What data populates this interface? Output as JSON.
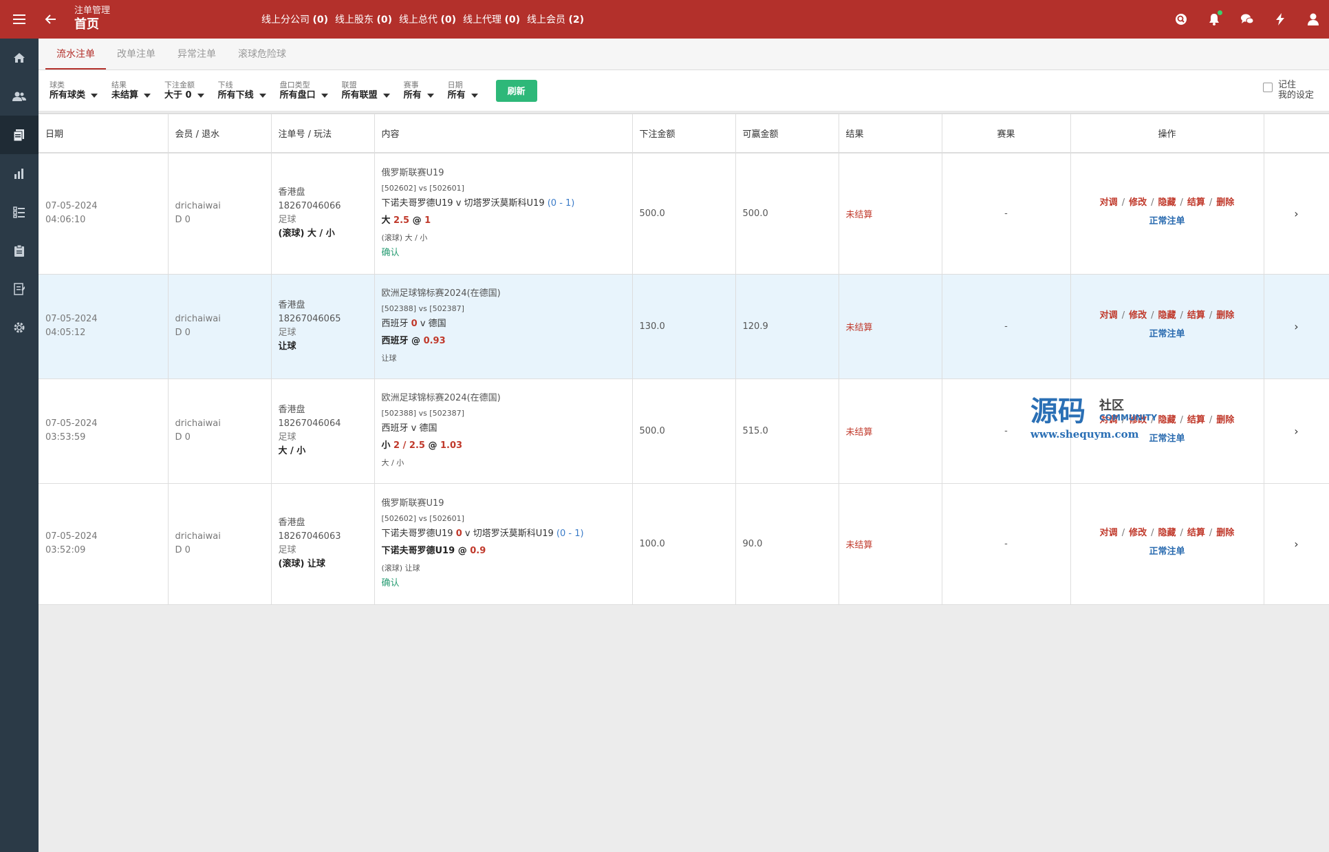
{
  "header": {
    "subtitle": "注单管理",
    "title": "首页",
    "online": [
      {
        "label": "线上分公司",
        "count": "(0)"
      },
      {
        "label": "线上股东",
        "count": "(0)"
      },
      {
        "label": "线上总代",
        "count": "(0)"
      },
      {
        "label": "线上代理",
        "count": "(0)"
      },
      {
        "label": "线上会员",
        "count": "(2)"
      }
    ],
    "icons": [
      "search-icon",
      "bell-icon",
      "chat-icon",
      "bolt-icon",
      "user-icon"
    ],
    "accent": "#b3302b"
  },
  "sidebar": {
    "items": [
      "home-icon",
      "users-icon",
      "documents-icon",
      "chart-icon",
      "list-icon",
      "clipboard-icon",
      "report-icon",
      "gear-icon"
    ],
    "active": 2
  },
  "tabs": [
    "流水注单",
    "改单注单",
    "异常注单",
    "滚球危险球"
  ],
  "filters": [
    {
      "label": "球类",
      "value": "所有球类"
    },
    {
      "label": "结果",
      "value": "未结算"
    },
    {
      "label": "下注金额",
      "value": "大于 0"
    },
    {
      "label": "下线",
      "value": "所有下线"
    },
    {
      "label": "盘口类型",
      "value": "所有盘口"
    },
    {
      "label": "联盟",
      "value": "所有联盟"
    },
    {
      "label": "赛事",
      "value": "所有"
    },
    {
      "label": "日期",
      "value": "所有"
    }
  ],
  "refresh_label": "刷新",
  "remember": {
    "line1": "记住",
    "line2": "我的设定"
  },
  "table": {
    "headers": [
      "日期",
      "会员 / 退水",
      "注单号 / 玩法",
      "内容",
      "下注金额",
      "可赢金额",
      "结果",
      "赛果",
      "操作"
    ],
    "action_labels": [
      "对调",
      "修改",
      "隐藏",
      "结算",
      "删除"
    ],
    "normal_label": "正常注单",
    "rows": [
      {
        "date": "07-05-2024",
        "time": "04:06:10",
        "member": "drichaiwai",
        "rebate": "D 0",
        "market": "香港盘",
        "bet_no": "18267046066",
        "sport": "足球",
        "play": "(滚球) 大 / 小",
        "league": "俄罗斯联赛U19",
        "ids": "[502602] vs [502601]",
        "home": "下诺夫哥罗德U19",
        "home_score": "",
        "away": "v 切塔罗沃莫斯科U19",
        "score": "(0 - 1)",
        "sel_prefix": "大",
        "sel_line": "2.5",
        "sel_at": "@",
        "sel_odd": "1",
        "sub": "(滚球) 大 / 小",
        "confirm": "确认",
        "amount": "500.0",
        "win": "500.0",
        "result": "未结算",
        "match_result": "-"
      },
      {
        "date": "07-05-2024",
        "time": "04:05:12",
        "member": "drichaiwai",
        "rebate": "D 0",
        "market": "香港盘",
        "bet_no": "18267046065",
        "sport": "足球",
        "play": "让球",
        "league": "欧洲足球锦标赛2024(在德国)",
        "ids": "[502388] vs [502387]",
        "home": "西班牙",
        "home_score": "0",
        "away": "v 德国",
        "score": "",
        "sel_prefix": "西班牙",
        "sel_line": "",
        "sel_at": "@",
        "sel_odd": "0.93",
        "sub": "让球",
        "confirm": "",
        "amount": "130.0",
        "win": "120.9",
        "result": "未结算",
        "match_result": "-"
      },
      {
        "date": "07-05-2024",
        "time": "03:53:59",
        "member": "drichaiwai",
        "rebate": "D 0",
        "market": "香港盘",
        "bet_no": "18267046064",
        "sport": "足球",
        "play": "大 / 小",
        "league": "欧洲足球锦标赛2024(在德国)",
        "ids": "[502388] vs [502387]",
        "home": "西班牙",
        "home_score": "",
        "away": "v 德国",
        "score": "",
        "sel_prefix": "小",
        "sel_line": "2 / 2.5",
        "sel_at": "@",
        "sel_odd": "1.03",
        "sub": "大 / 小",
        "confirm": "",
        "amount": "500.0",
        "win": "515.0",
        "result": "未结算",
        "match_result": "-"
      },
      {
        "date": "07-05-2024",
        "time": "03:52:09",
        "member": "drichaiwai",
        "rebate": "D 0",
        "market": "香港盘",
        "bet_no": "18267046063",
        "sport": "足球",
        "play": "(滚球) 让球",
        "league": "俄罗斯联赛U19",
        "ids": "[502602] vs [502601]",
        "home": "下诺夫哥罗德U19",
        "home_score": "0",
        "away": "v 切塔罗沃莫斯科U19",
        "score": "(0 - 1)",
        "sel_prefix": "下诺夫哥罗德U19",
        "sel_line": "",
        "sel_at": "@",
        "sel_odd": "0.9",
        "sub": "(滚球) 让球",
        "confirm": "确认",
        "amount": "100.0",
        "win": "90.0",
        "result": "未结算",
        "match_result": "-"
      }
    ]
  },
  "watermark": {
    "main": "源码",
    "side1": "社区",
    "side2": "COMMUNITY",
    "url": "www.shequym.com"
  }
}
